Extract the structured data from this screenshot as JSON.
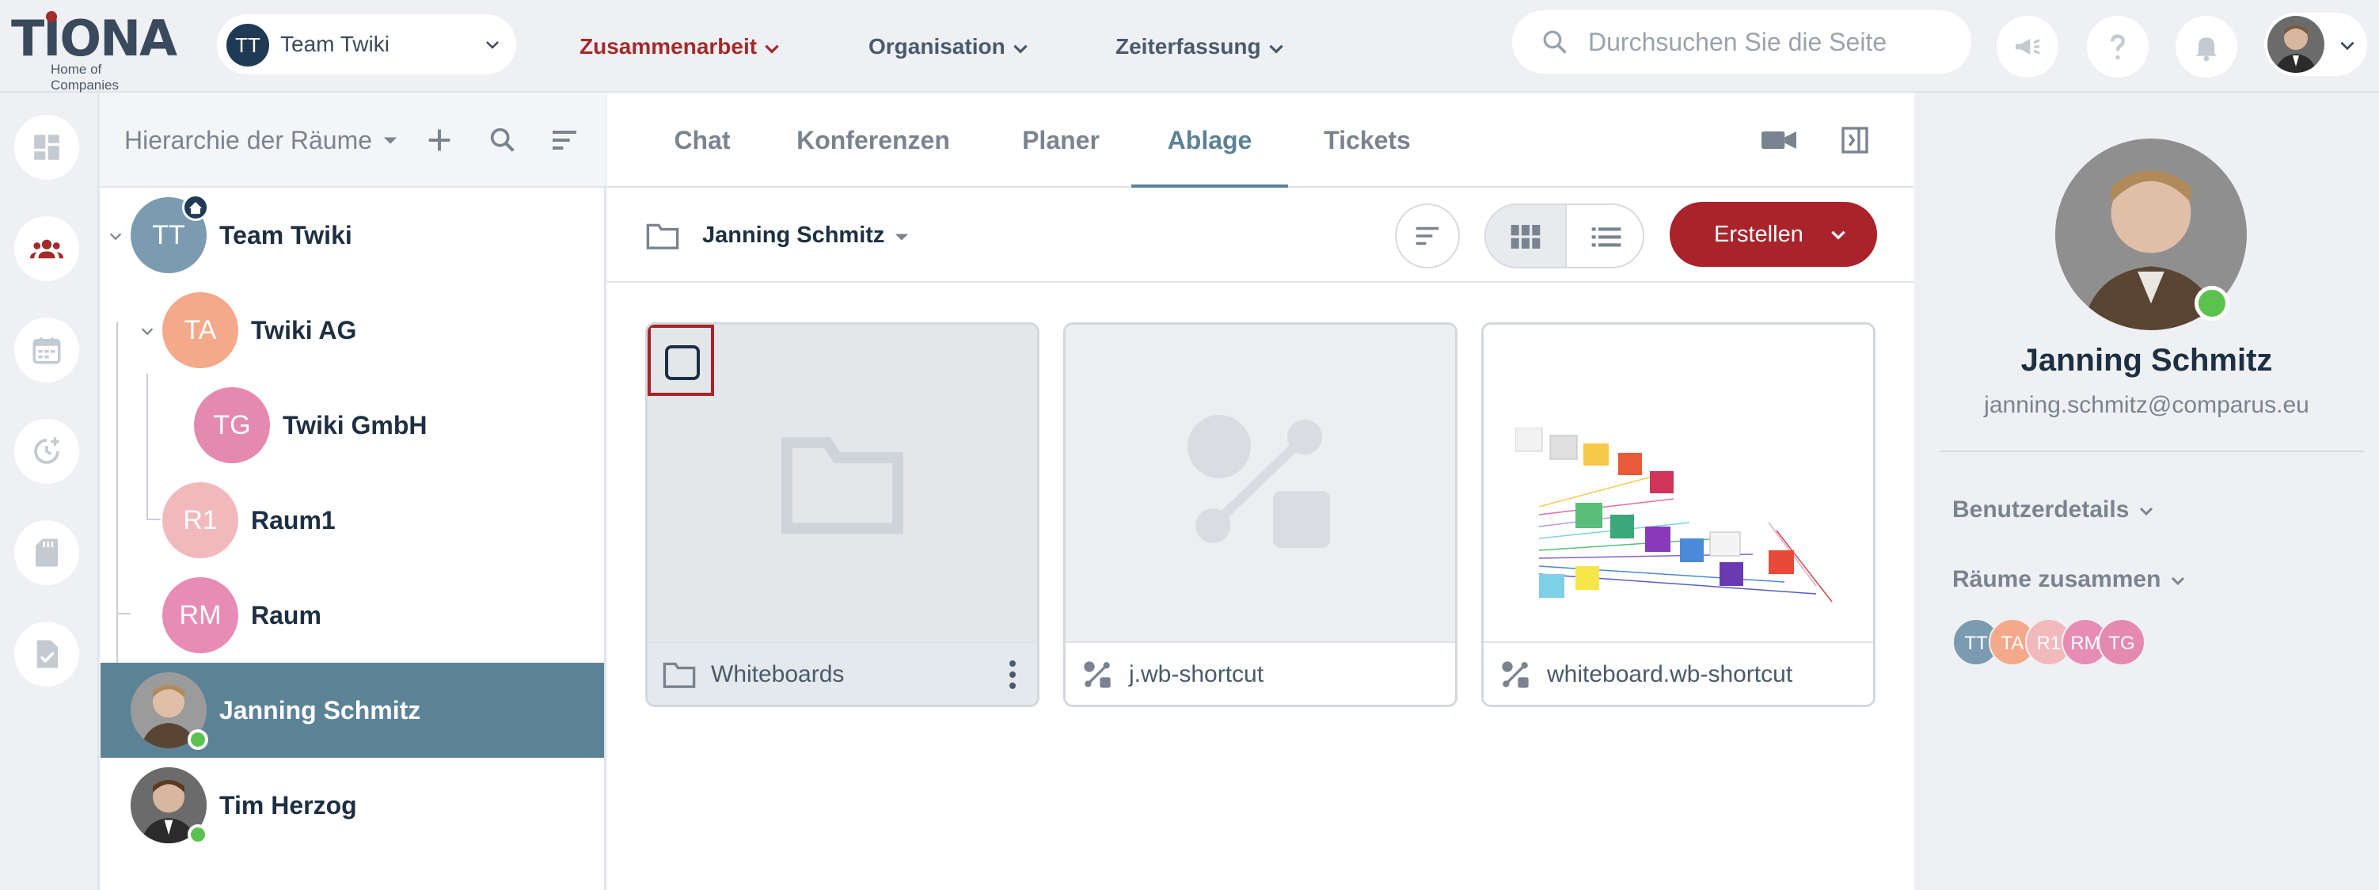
{
  "brand": {
    "logo": "TIONA",
    "tagline": "Home of Companies"
  },
  "team_selector": {
    "avatar": "TT",
    "label": "Team Twiki"
  },
  "nav": [
    {
      "label": "Zusammenarbeit",
      "active": true
    },
    {
      "label": "Organisation",
      "active": false
    },
    {
      "label": "Zeiterfassung",
      "active": false
    }
  ],
  "search": {
    "placeholder": "Durchsuchen Sie die Seite"
  },
  "header_icons": [
    "megaphone-icon",
    "help-icon",
    "bell-icon"
  ],
  "rail_icons": [
    "dashboard-icon",
    "team-icon",
    "calendar-icon",
    "time-tracking-icon",
    "sd-card-icon",
    "task-document-icon"
  ],
  "hierarchy": {
    "title": "Hierarchie der Räume",
    "items": [
      {
        "initials": "TT",
        "name": "Team Twiki",
        "color": "#7a9bb0"
      },
      {
        "initials": "TA",
        "name": "Twiki AG",
        "color": "#f4a98a"
      },
      {
        "initials": "TG",
        "name": "Twiki GmbH",
        "color": "#e489b0"
      },
      {
        "initials": "R1",
        "name": "Raum1",
        "color": "#f2b9bd"
      },
      {
        "initials": "RM",
        "name": "Raum",
        "color": "#e68cb6"
      },
      {
        "name": "Janning Schmitz",
        "selected": true
      },
      {
        "name": "Tim Herzog"
      }
    ]
  },
  "tabs": [
    {
      "label": "Chat"
    },
    {
      "label": "Konferenzen"
    },
    {
      "label": "Planer"
    },
    {
      "label": "Ablage",
      "active": true
    },
    {
      "label": "Tickets"
    }
  ],
  "toolbar": {
    "path": "Janning Schmitz",
    "create_label": "Erstellen"
  },
  "files": [
    {
      "name": "Whiteboards",
      "type": "folder"
    },
    {
      "name": "j.wb-shortcut",
      "type": "shortcut"
    },
    {
      "name": "whiteboard.wb-shortcut",
      "type": "shortcut"
    }
  ],
  "profile": {
    "name": "Janning Schmitz",
    "email": "janning.schmitz@comparus.eu",
    "sections": [
      "Benutzerdetails",
      "Räume zusammen"
    ],
    "shared_rooms": [
      {
        "initials": "TT",
        "color": "#7a9bb0"
      },
      {
        "initials": "TA",
        "color": "#f4a98a"
      },
      {
        "initials": "R1",
        "color": "#f2b9bd"
      },
      {
        "initials": "RM",
        "color": "#e68cb6"
      },
      {
        "initials": "TG",
        "color": "#e489b0"
      }
    ]
  },
  "colors": {
    "accent": "#a8232a",
    "selected_row": "#5c8296",
    "online": "#5cc24e"
  }
}
